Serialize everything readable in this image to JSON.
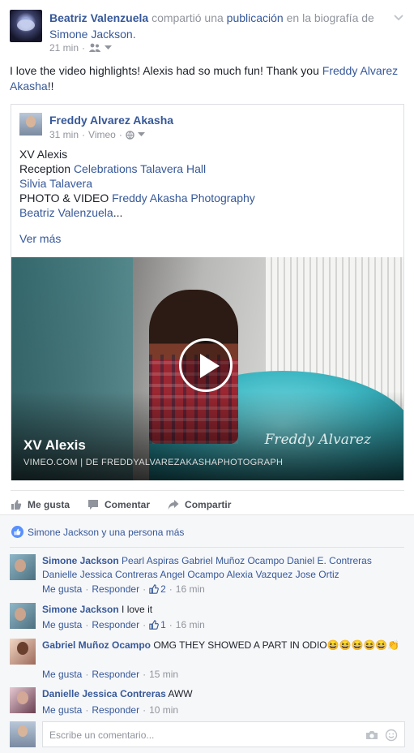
{
  "post": {
    "author": "Beatriz Valenzuela",
    "shared_text": "compartió una",
    "publication": "publicación",
    "on_text": "en la biografía de",
    "target": "Simone Jackson.",
    "time": "21 min",
    "text_before": "I love the video highlights! Alexis had so much fun! Thank you ",
    "text_tag": "Freddy Alvarez Akasha",
    "text_after": "!!"
  },
  "shared": {
    "author": "Freddy Alvarez Akasha",
    "time": "31 min",
    "source": "Vimeo",
    "line1": "XV Alexis",
    "line2_prefix": "Reception ",
    "line2_link": "Celebrations Talavera Hall",
    "line3_link": "Silvia Talavera",
    "line4_prefix": "PHOTO & VIDEO ",
    "line4_link": "Freddy Akasha Photography",
    "line5_link": "Beatriz Valenzuela",
    "line5_suffix": "...",
    "see_more": "Ver más",
    "video": {
      "title": "XV Alexis",
      "domain": "VIMEO.COM",
      "divider": "|",
      "by": "DE FREDDYALVAREZAKASHAPHOTOGRAPH",
      "watermark": "Freddy Alvarez"
    }
  },
  "actions": {
    "like": "Me gusta",
    "comment": "Comentar",
    "share": "Compartir"
  },
  "reactions": {
    "summary": "Simone Jackson y una persona más"
  },
  "comments": [
    {
      "name": "Simone Jackson",
      "text": " Pearl Aspiras Gabriel Muñoz Ocampo Daniel E. Contreras Danielle Jessica Contreras Angel Ocampo Alexia Vazquez Jose Ortiz",
      "like": "Me gusta",
      "reply": "Responder",
      "likes": "2",
      "time": "16 min"
    },
    {
      "name": "Simone Jackson",
      "text": " I love it",
      "like": "Me gusta",
      "reply": "Responder",
      "likes": "1",
      "time": "16 min"
    },
    {
      "name": "Gabriel Muñoz Ocampo",
      "text": " OMG THEY SHOWED A PART IN ODIO😆😆😆😆😆👏",
      "like": "Me gusta",
      "reply": "Responder",
      "time": "15 min"
    },
    {
      "name": "Danielle Jessica Contreras",
      "text": " AWW",
      "like": "Me gusta",
      "reply": "Responder",
      "time": "10 min"
    }
  ],
  "composer": {
    "placeholder": "Escribe un comentario..."
  },
  "meta_separator": "·",
  "colors": {
    "link": "#365899",
    "muted": "#90949c",
    "comment_bg": "#f6f7f9",
    "like_blue": "#5890ff"
  }
}
